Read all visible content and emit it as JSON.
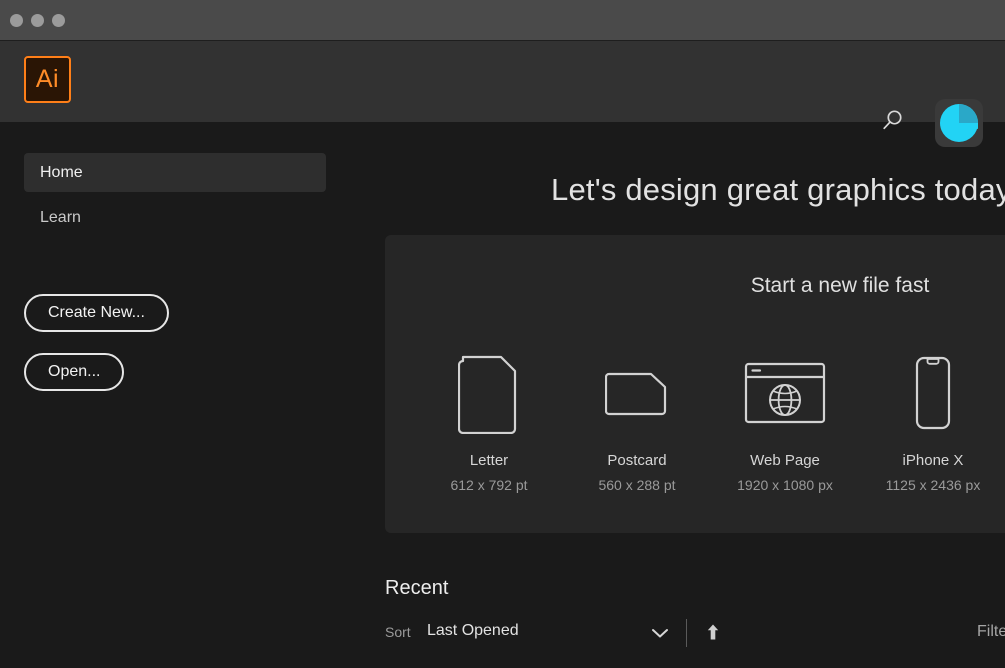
{
  "window": {
    "traffic_lights": [
      "close",
      "minimize",
      "zoom"
    ]
  },
  "header": {
    "logo_text": "Ai",
    "search_icon": "search-icon",
    "avatar_icon": "user-avatar",
    "accent_color": "#ff7f18",
    "avatar_color": "#22d3f5"
  },
  "sidebar": {
    "items": [
      {
        "label": "Home",
        "active": true
      },
      {
        "label": "Learn",
        "active": false
      }
    ],
    "buttons": [
      {
        "label": "Create New..."
      },
      {
        "label": "Open..."
      }
    ]
  },
  "main": {
    "hero_title": "Let's design great graphics today,",
    "panel": {
      "title": "Start a new file fast",
      "presets": [
        {
          "name": "Letter",
          "dimensions": "612 x 792 pt",
          "icon": "document-portrait-icon"
        },
        {
          "name": "Postcard",
          "dimensions": "560 x 288 pt",
          "icon": "document-landscape-icon"
        },
        {
          "name": "Web Page",
          "dimensions": "1920 x 1080 px",
          "icon": "browser-globe-icon"
        },
        {
          "name": "iPhone X",
          "dimensions": "1125 x 2436 px",
          "icon": "phone-icon"
        }
      ]
    },
    "recent": {
      "title": "Recent",
      "sort_label": "Sort",
      "sort_value": "Last Opened",
      "sort_direction_icon": "arrow-up-icon",
      "chevron_icon": "chevron-down-icon",
      "filter_label": "Filte"
    }
  }
}
